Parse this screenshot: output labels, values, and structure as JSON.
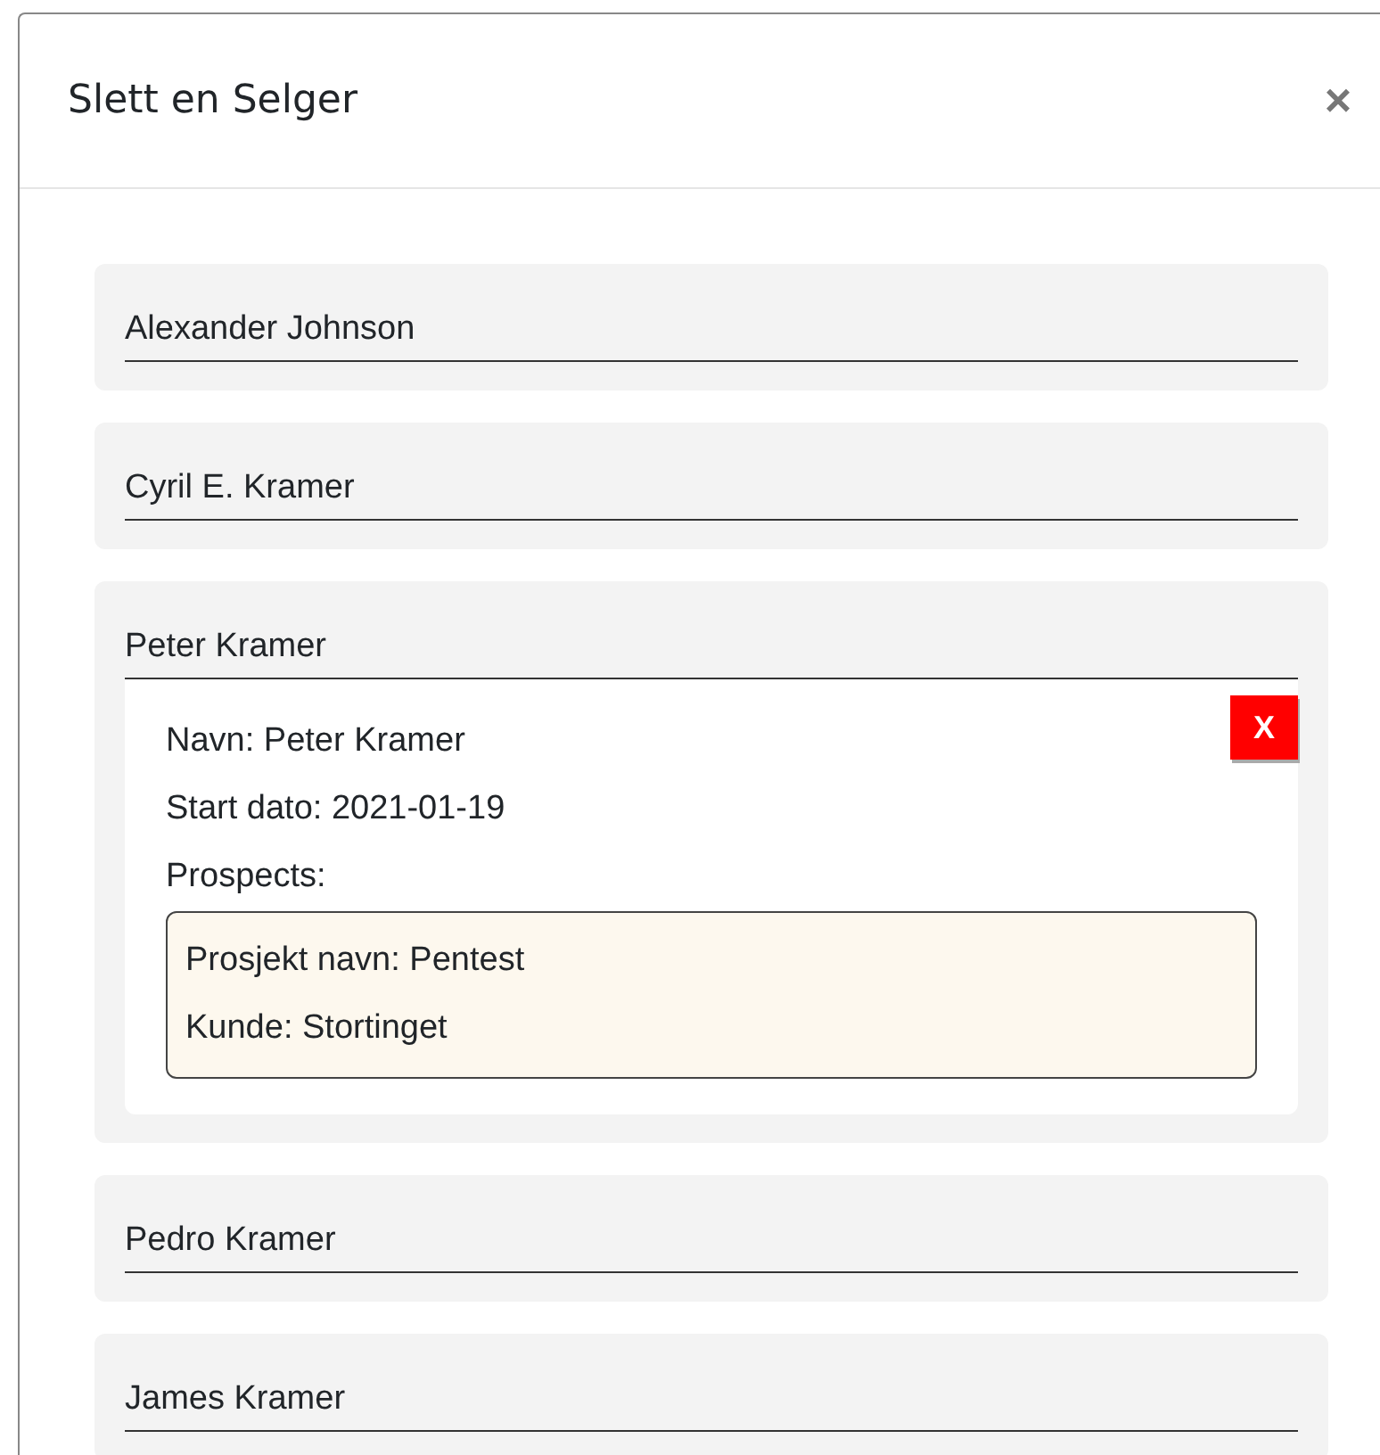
{
  "modal": {
    "title": "Slett en Selger",
    "close": "×"
  },
  "sellers": [
    {
      "name": "Alexander Johnson"
    },
    {
      "name": "Cyril E. Kramer"
    },
    {
      "name": "Peter Kramer",
      "details": {
        "lines": [
          "Navn: Peter Kramer",
          "Start dato: 2021-01-19"
        ],
        "prospects_label": "Prospects:",
        "prospects": [
          {
            "lines": [
              "Prosjekt navn: Pentest",
              "Kunde: Stortinget"
            ]
          }
        ],
        "delete_button": "X"
      }
    },
    {
      "name": "Pedro Kramer"
    },
    {
      "name": "James Kramer"
    }
  ]
}
